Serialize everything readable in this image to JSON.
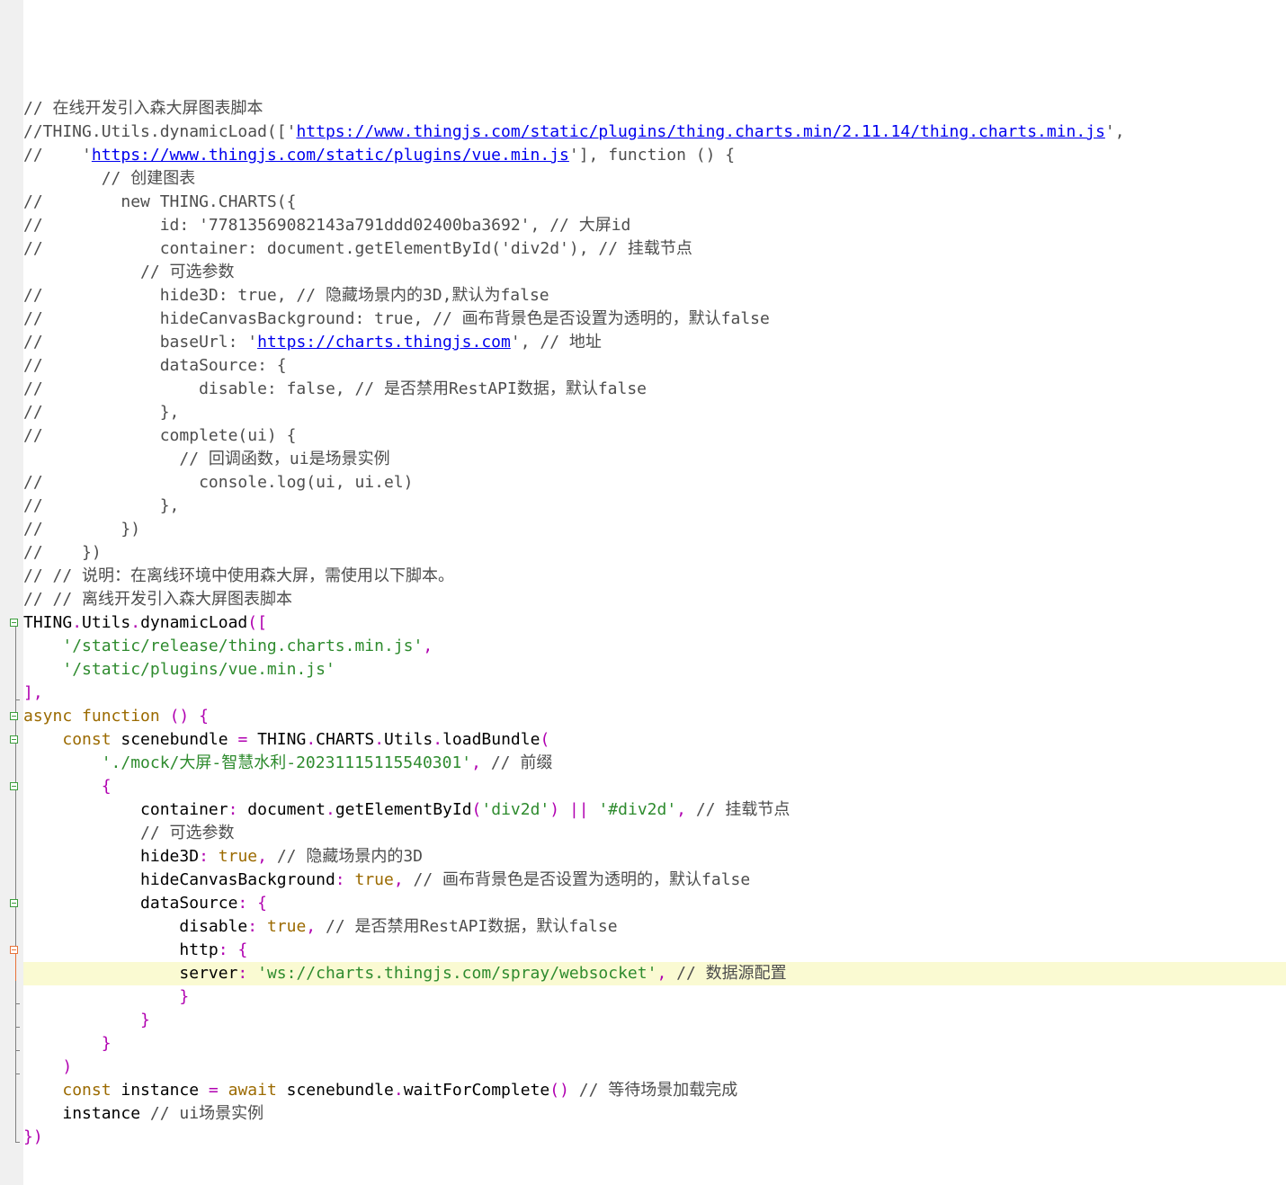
{
  "editor": {
    "lines": [
      {
        "indent": "",
        "tokens": [
          {
            "t": "cm",
            "v": "// 在线开发引入森大屏图表脚本"
          }
        ]
      },
      {
        "indent": "",
        "tokens": [
          {
            "t": "cm",
            "v": "//THING.Utils.dynamicLoad(['"
          },
          {
            "t": "url",
            "v": "https://www.thingjs.com/static/plugins/thing.charts.min/2.11.14/thing.charts.min.js"
          },
          {
            "t": "cm",
            "v": "',"
          }
        ]
      },
      {
        "indent": "",
        "tokens": [
          {
            "t": "cm",
            "v": "//    '"
          },
          {
            "t": "url",
            "v": "https://www.thingjs.com/static/plugins/vue.min.js"
          },
          {
            "t": "cm",
            "v": "'], function () {"
          }
        ]
      },
      {
        "indent": "        ",
        "tokens": [
          {
            "t": "cm",
            "v": "// 创建图表"
          }
        ]
      },
      {
        "indent": "",
        "tokens": [
          {
            "t": "cm",
            "v": "//        new THING.CHARTS({"
          }
        ]
      },
      {
        "indent": "",
        "tokens": [
          {
            "t": "cm",
            "v": "//            id: '77813569082143a791ddd02400ba3692', // 大屏id"
          }
        ]
      },
      {
        "indent": "",
        "tokens": [
          {
            "t": "cm",
            "v": "//            container: document.getElementById('div2d'), // 挂载节点"
          }
        ]
      },
      {
        "indent": "            ",
        "tokens": [
          {
            "t": "cm",
            "v": "// 可选参数"
          }
        ]
      },
      {
        "indent": "",
        "tokens": [
          {
            "t": "cm",
            "v": "//            hide3D: true, // 隐藏场景内的3D,默认为false"
          }
        ]
      },
      {
        "indent": "",
        "tokens": [
          {
            "t": "cm",
            "v": "//            hideCanvasBackground: true, // 画布背景色是否设置为透明的，默认false"
          }
        ]
      },
      {
        "indent": "",
        "tokens": [
          {
            "t": "cm",
            "v": "//            baseUrl: '"
          },
          {
            "t": "url",
            "v": "https://charts.thingjs.com"
          },
          {
            "t": "cm",
            "v": "', // 地址"
          }
        ]
      },
      {
        "indent": "",
        "tokens": [
          {
            "t": "cm",
            "v": "//            dataSource: {"
          }
        ]
      },
      {
        "indent": "",
        "tokens": [
          {
            "t": "cm",
            "v": "//                disable: false, // 是否禁用RestAPI数据，默认false"
          }
        ]
      },
      {
        "indent": "",
        "tokens": [
          {
            "t": "cm",
            "v": "//            },"
          }
        ]
      },
      {
        "indent": "",
        "tokens": [
          {
            "t": "cm",
            "v": "//            complete(ui) {"
          }
        ]
      },
      {
        "indent": "                ",
        "tokens": [
          {
            "t": "cm",
            "v": "// 回调函数，ui是场景实例"
          }
        ]
      },
      {
        "indent": "",
        "tokens": [
          {
            "t": "cm",
            "v": "//                console.log(ui, ui.el)"
          }
        ]
      },
      {
        "indent": "",
        "tokens": [
          {
            "t": "cm",
            "v": "//            },"
          }
        ]
      },
      {
        "indent": "",
        "tokens": [
          {
            "t": "cm",
            "v": "//        })"
          }
        ]
      },
      {
        "indent": "",
        "tokens": [
          {
            "t": "cm",
            "v": "//    })"
          }
        ]
      },
      {
        "indent": "",
        "tokens": [
          {
            "t": "cm",
            "v": "// // 说明：在离线环境中使用森大屏，需使用以下脚本。"
          }
        ]
      },
      {
        "indent": "",
        "tokens": [
          {
            "t": "cm",
            "v": "// // 离线开发引入森大屏图表脚本"
          }
        ]
      },
      {
        "indent": "",
        "tokens": [
          {
            "t": "pl",
            "v": "THING"
          },
          {
            "t": "op",
            "v": "."
          },
          {
            "t": "pl",
            "v": "Utils"
          },
          {
            "t": "op",
            "v": "."
          },
          {
            "t": "pl",
            "v": "dynamicLoad"
          },
          {
            "t": "pn",
            "v": "(["
          }
        ]
      },
      {
        "indent": "    ",
        "tokens": [
          {
            "t": "str",
            "v": "'/static/release/thing.charts.min.js'"
          },
          {
            "t": "op",
            "v": ","
          }
        ]
      },
      {
        "indent": "    ",
        "tokens": [
          {
            "t": "str",
            "v": "'/static/plugins/vue.min.js'"
          }
        ]
      },
      {
        "indent": "",
        "tokens": [
          {
            "t": "pn",
            "v": "],"
          }
        ]
      },
      {
        "indent": "",
        "tokens": [
          {
            "t": "kw",
            "v": "async function"
          },
          {
            "t": "pl",
            "v": " "
          },
          {
            "t": "pn",
            "v": "()"
          },
          {
            "t": "pl",
            "v": " "
          },
          {
            "t": "pn",
            "v": "{"
          }
        ]
      },
      {
        "indent": "    ",
        "tokens": [
          {
            "t": "kw",
            "v": "const"
          },
          {
            "t": "pl",
            "v": " scenebundle "
          },
          {
            "t": "op",
            "v": "="
          },
          {
            "t": "pl",
            "v": " THING"
          },
          {
            "t": "op",
            "v": "."
          },
          {
            "t": "pl",
            "v": "CHARTS"
          },
          {
            "t": "op",
            "v": "."
          },
          {
            "t": "pl",
            "v": "Utils"
          },
          {
            "t": "op",
            "v": "."
          },
          {
            "t": "pl",
            "v": "loadBundle"
          },
          {
            "t": "pn",
            "v": "("
          }
        ]
      },
      {
        "indent": "        ",
        "tokens": [
          {
            "t": "str",
            "v": "'./mock/大屏-智慧水利-20231115115540301'"
          },
          {
            "t": "op",
            "v": ","
          },
          {
            "t": "pl",
            "v": " "
          },
          {
            "t": "cm",
            "v": "// 前缀"
          }
        ]
      },
      {
        "indent": "        ",
        "tokens": [
          {
            "t": "pn",
            "v": "{"
          }
        ]
      },
      {
        "indent": "            ",
        "tokens": [
          {
            "t": "pl",
            "v": "container"
          },
          {
            "t": "op",
            "v": ":"
          },
          {
            "t": "pl",
            "v": " document"
          },
          {
            "t": "op",
            "v": "."
          },
          {
            "t": "pl",
            "v": "getElementById"
          },
          {
            "t": "pn",
            "v": "("
          },
          {
            "t": "str",
            "v": "'div2d'"
          },
          {
            "t": "pn",
            "v": ")"
          },
          {
            "t": "pl",
            "v": " "
          },
          {
            "t": "op",
            "v": "||"
          },
          {
            "t": "pl",
            "v": " "
          },
          {
            "t": "str",
            "v": "'#div2d'"
          },
          {
            "t": "op",
            "v": ","
          },
          {
            "t": "pl",
            "v": " "
          },
          {
            "t": "cm",
            "v": "// 挂载节点"
          }
        ]
      },
      {
        "indent": "            ",
        "tokens": [
          {
            "t": "cm",
            "v": "// 可选参数"
          }
        ]
      },
      {
        "indent": "            ",
        "tokens": [
          {
            "t": "pl",
            "v": "hide3D"
          },
          {
            "t": "op",
            "v": ":"
          },
          {
            "t": "pl",
            "v": " "
          },
          {
            "t": "kw",
            "v": "true"
          },
          {
            "t": "op",
            "v": ","
          },
          {
            "t": "pl",
            "v": " "
          },
          {
            "t": "cm",
            "v": "// 隐藏场景内的3D"
          }
        ]
      },
      {
        "indent": "            ",
        "tokens": [
          {
            "t": "pl",
            "v": "hideCanvasBackground"
          },
          {
            "t": "op",
            "v": ":"
          },
          {
            "t": "pl",
            "v": " "
          },
          {
            "t": "kw",
            "v": "true"
          },
          {
            "t": "op",
            "v": ","
          },
          {
            "t": "pl",
            "v": " "
          },
          {
            "t": "cm",
            "v": "// 画布背景色是否设置为透明的，默认false"
          }
        ]
      },
      {
        "indent": "            ",
        "tokens": [
          {
            "t": "pl",
            "v": "dataSource"
          },
          {
            "t": "op",
            "v": ":"
          },
          {
            "t": "pl",
            "v": " "
          },
          {
            "t": "pn",
            "v": "{"
          }
        ]
      },
      {
        "indent": "                ",
        "tokens": [
          {
            "t": "pl",
            "v": "disable"
          },
          {
            "t": "op",
            "v": ":"
          },
          {
            "t": "pl",
            "v": " "
          },
          {
            "t": "kw",
            "v": "true"
          },
          {
            "t": "op",
            "v": ","
          },
          {
            "t": "pl",
            "v": " "
          },
          {
            "t": "cm",
            "v": "// 是否禁用RestAPI数据，默认false"
          }
        ]
      },
      {
        "indent": "                ",
        "tokens": [
          {
            "t": "pl",
            "v": "http"
          },
          {
            "t": "op",
            "v": ":"
          },
          {
            "t": "pl",
            "v": " "
          },
          {
            "t": "pn",
            "v": "{"
          }
        ]
      },
      {
        "indent": "                ",
        "highlight": true,
        "tokens": [
          {
            "t": "pl",
            "v": "server"
          },
          {
            "t": "op",
            "v": ":"
          },
          {
            "t": "pl",
            "v": " "
          },
          {
            "t": "str",
            "v": "'ws://charts.thingjs.com/spray/websocket'"
          },
          {
            "t": "op",
            "v": ","
          },
          {
            "t": "pl",
            "v": " "
          },
          {
            "t": "cm",
            "v": "// 数据源配置"
          }
        ]
      },
      {
        "indent": "                ",
        "tokens": [
          {
            "t": "pn",
            "v": "}"
          }
        ]
      },
      {
        "indent": "            ",
        "tokens": [
          {
            "t": "pn",
            "v": "}"
          }
        ]
      },
      {
        "indent": "        ",
        "tokens": [
          {
            "t": "pn",
            "v": "}"
          }
        ]
      },
      {
        "indent": "    ",
        "tokens": [
          {
            "t": "pn",
            "v": ")"
          }
        ]
      },
      {
        "indent": "    ",
        "tokens": [
          {
            "t": "kw",
            "v": "const"
          },
          {
            "t": "pl",
            "v": " instance "
          },
          {
            "t": "op",
            "v": "="
          },
          {
            "t": "pl",
            "v": " "
          },
          {
            "t": "kw",
            "v": "await"
          },
          {
            "t": "pl",
            "v": " scenebundle"
          },
          {
            "t": "op",
            "v": "."
          },
          {
            "t": "pl",
            "v": "waitForComplete"
          },
          {
            "t": "pn",
            "v": "()"
          },
          {
            "t": "pl",
            "v": " "
          },
          {
            "t": "cm",
            "v": "// 等待场景加载完成"
          }
        ]
      },
      {
        "indent": "    ",
        "tokens": [
          {
            "t": "pl",
            "v": "instance "
          },
          {
            "t": "cm",
            "v": "// ui场景实例"
          }
        ]
      },
      {
        "indent": "",
        "tokens": [
          {
            "t": "pn",
            "v": "})"
          }
        ]
      }
    ]
  }
}
